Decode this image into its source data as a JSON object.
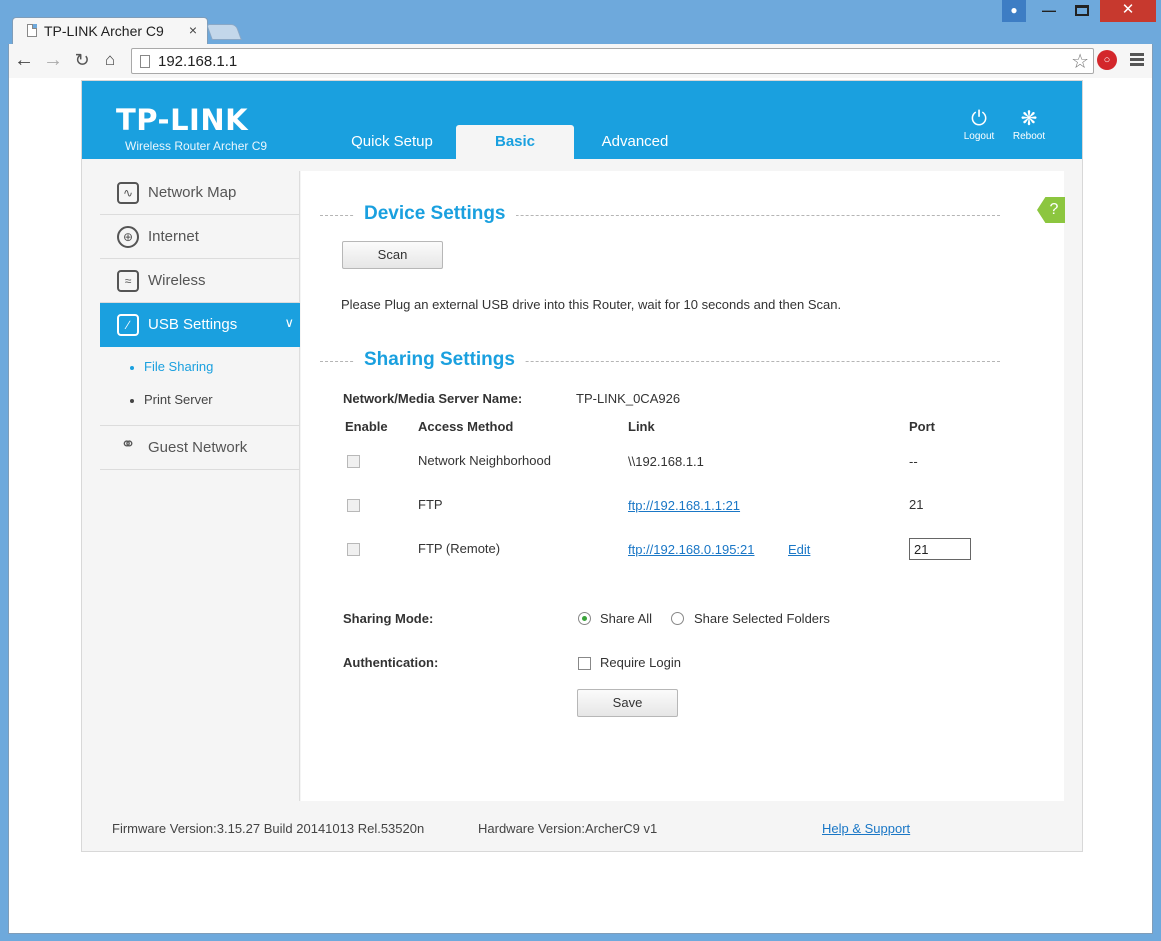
{
  "browser": {
    "tab_title": "TP-LINK Archer C9",
    "tab_close": "×",
    "url": "192.168.1.1"
  },
  "header": {
    "logo": "TP-LINK",
    "model": "Wireless Router Archer C9",
    "tabs": [
      {
        "label": "Quick Setup"
      },
      {
        "label": "Basic"
      },
      {
        "label": "Advanced"
      }
    ],
    "logout_label": "Logout",
    "reboot_label": "Reboot",
    "accent_color": "#1aa0df"
  },
  "sidebar": {
    "items": [
      {
        "label": "Network Map"
      },
      {
        "label": "Internet"
      },
      {
        "label": "Wireless"
      },
      {
        "label": "USB Settings"
      },
      {
        "label": "Guest Network"
      }
    ],
    "sub_items": [
      {
        "label": "File Sharing"
      },
      {
        "label": "Print Server"
      }
    ]
  },
  "device_settings": {
    "title": "Device Settings",
    "scan_label": "Scan",
    "hint": "Please Plug an external USB drive into this Router, wait for 10 seconds and then Scan."
  },
  "sharing_settings": {
    "title": "Sharing Settings",
    "server_name_label": "Network/Media Server Name:",
    "server_name_value": "TP-LINK_0CA926",
    "columns": {
      "enable": "Enable",
      "access": "Access Method",
      "link": "Link",
      "port": "Port"
    },
    "rows": [
      {
        "access": "Network Neighborhood",
        "link": "\\\\192.168.1.1",
        "port": "--"
      },
      {
        "access": "FTP",
        "link": "ftp://192.168.1.1:21",
        "port": "21"
      },
      {
        "access": "FTP (Remote)",
        "link": "ftp://192.168.0.195:21",
        "edit": "Edit",
        "port": "21"
      }
    ],
    "sharing_mode_label": "Sharing Mode:",
    "share_all": "Share All",
    "share_selected": "Share Selected Folders",
    "auth_label": "Authentication:",
    "require_login": "Require Login",
    "save_label": "Save"
  },
  "help_icon": "?",
  "footer": {
    "firmware": "Firmware Version:3.15.27 Build 20141013 Rel.53520n",
    "hardware": "Hardware Version:ArcherC9 v1",
    "help_link": "Help & Support"
  }
}
